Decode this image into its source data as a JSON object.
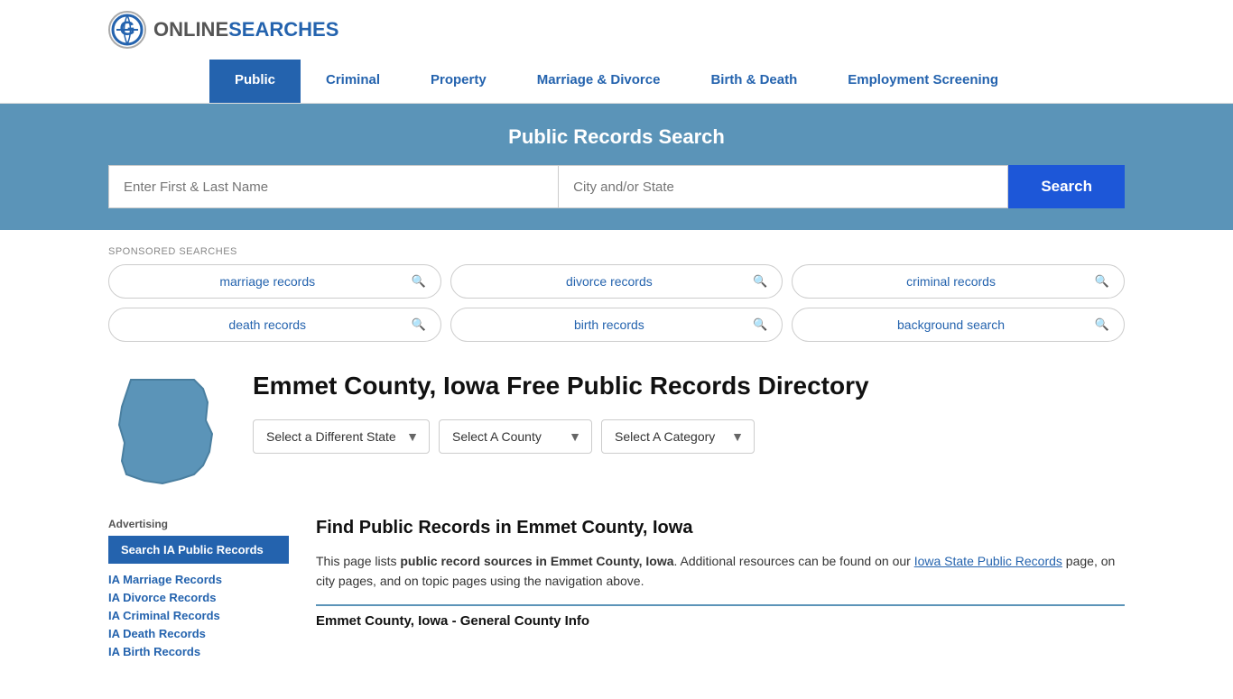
{
  "logo": {
    "online": "ONLINE",
    "searches": "SEARCHES"
  },
  "nav": {
    "items": [
      {
        "label": "Public",
        "active": true
      },
      {
        "label": "Criminal",
        "active": false
      },
      {
        "label": "Property",
        "active": false
      },
      {
        "label": "Marriage & Divorce",
        "active": false
      },
      {
        "label": "Birth & Death",
        "active": false
      },
      {
        "label": "Employment Screening",
        "active": false
      }
    ]
  },
  "search_banner": {
    "title": "Public Records Search",
    "name_placeholder": "Enter First & Last Name",
    "city_placeholder": "City and/or State",
    "search_button": "Search"
  },
  "sponsored": {
    "label": "SPONSORED SEARCHES",
    "items": [
      "marriage records",
      "divorce records",
      "criminal records",
      "death records",
      "birth records",
      "background search"
    ]
  },
  "county": {
    "title": "Emmet County, Iowa Free Public Records Directory"
  },
  "dropdowns": {
    "state": "Select a Different State",
    "county": "Select A County",
    "category": "Select A Category"
  },
  "content": {
    "find_title": "Find Public Records in Emmet County, Iowa",
    "description_start": "This page lists ",
    "description_bold": "public record sources in Emmet County, Iowa",
    "description_mid": ". Additional resources can be found on our ",
    "description_link": "Iowa State Public Records",
    "description_end": " page, on city pages, and on topic pages using the navigation above.",
    "general_info": "Emmet County, Iowa - General County Info"
  },
  "sidebar": {
    "advertising_label": "Advertising",
    "cta_button": "Search IA Public Records",
    "links": [
      "IA Marriage Records",
      "IA Divorce Records",
      "IA Criminal Records",
      "IA Death Records",
      "IA Birth Records"
    ]
  }
}
